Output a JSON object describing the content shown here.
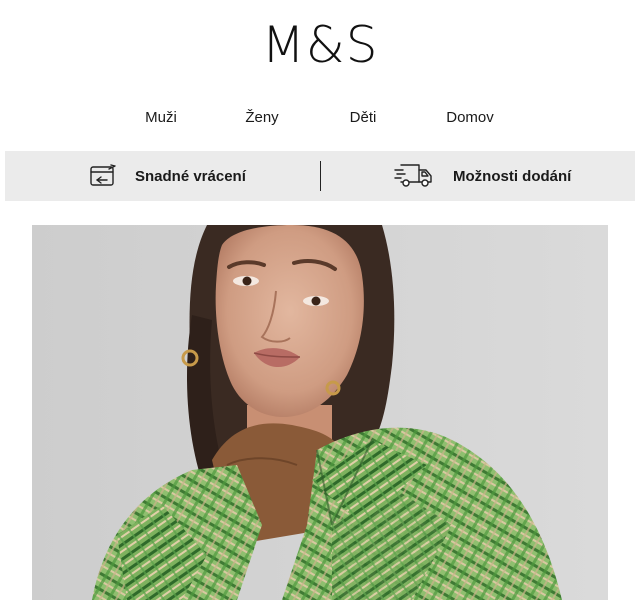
{
  "brand": {
    "logo_text": "M&S"
  },
  "nav": {
    "items": [
      {
        "label": "Muži"
      },
      {
        "label": "Ženy"
      },
      {
        "label": "Děti"
      },
      {
        "label": "Domov"
      }
    ]
  },
  "services": {
    "returns": {
      "label": "Snadné vrácení",
      "icon": "returns-icon"
    },
    "delivery": {
      "label": "Možnosti dodání",
      "icon": "delivery-truck-icon"
    }
  },
  "hero": {
    "image": "woman-in-green-tweed-coat",
    "colors": {
      "background": "#d6d6d6",
      "coat_green": "#5e9a4a",
      "sweater": "#8a5a38"
    }
  }
}
